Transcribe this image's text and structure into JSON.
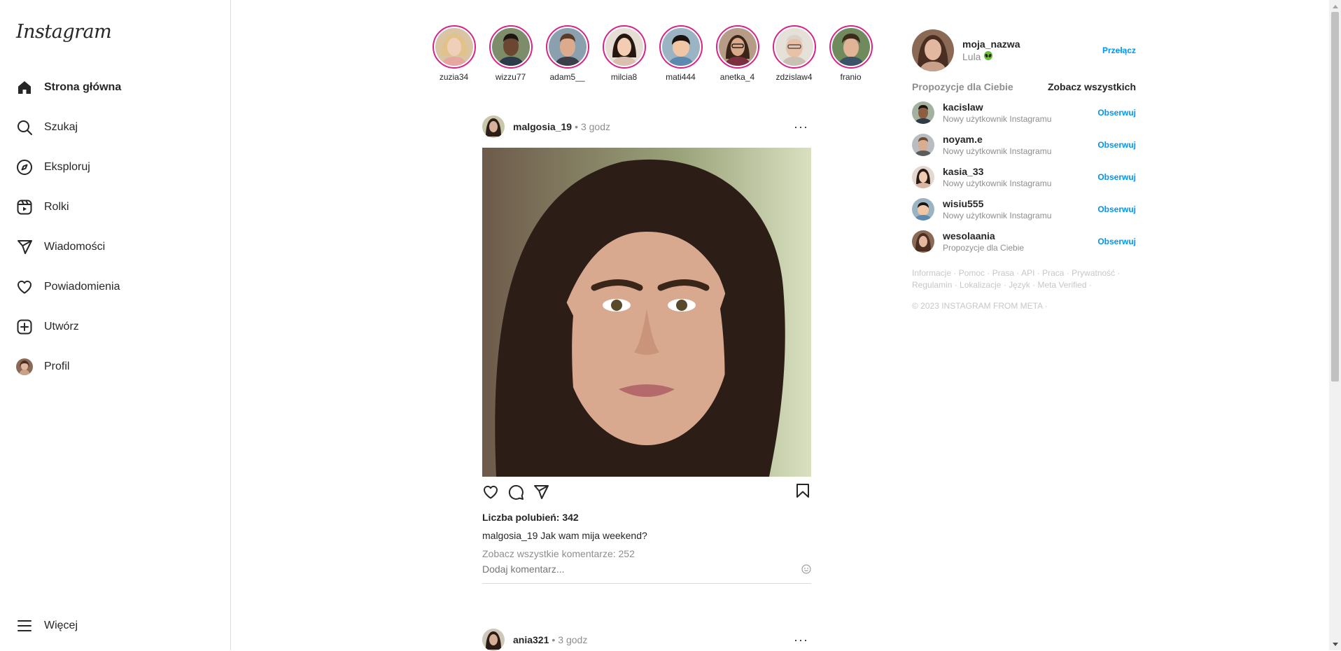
{
  "app": {
    "logo": "Instagram"
  },
  "nav": {
    "home": "Strona główna",
    "search": "Szukaj",
    "explore": "Eksploruj",
    "reels": "Rolki",
    "messages": "Wiadomości",
    "notifications": "Powiadomienia",
    "create": "Utwórz",
    "profile": "Profil",
    "more": "Więcej"
  },
  "stories": [
    {
      "name": "zuzia34"
    },
    {
      "name": "wizzu77"
    },
    {
      "name": "adam5__"
    },
    {
      "name": "milcia8"
    },
    {
      "name": "mati444"
    },
    {
      "name": "anetka_4"
    },
    {
      "name": "zdzislaw4"
    },
    {
      "name": "franio"
    }
  ],
  "post1": {
    "user": "malgosia_19",
    "dot": "•",
    "time": "3 godz",
    "menu": "···",
    "likes": "Liczba polubień: 342",
    "caption_user": "malgosia_19",
    "caption_text": "Jak wam mija weekend?",
    "comments_link": "Zobacz wszystkie komentarze: 252",
    "add_comment_placeholder": "Dodaj komentarz..."
  },
  "post2": {
    "user": "ania321",
    "dot": "•",
    "time": "3 godz",
    "menu": "···"
  },
  "me": {
    "username": "moja_nazwa",
    "name": "Lula",
    "switch": "Przełącz"
  },
  "suggestions": {
    "title": "Propozycje dla Ciebie",
    "see_all": "Zobacz wszystkich",
    "follow_label": "Obserwuj",
    "items": [
      {
        "user": "kacislaw",
        "sub": "Nowy użytkownik Instagramu"
      },
      {
        "user": "noyam.e",
        "sub": "Nowy użytkownik Instagramu"
      },
      {
        "user": "kasia_33",
        "sub": "Nowy użytkownik Instagramu"
      },
      {
        "user": "wisiu555",
        "sub": "Nowy użytkownik Instagramu"
      },
      {
        "user": "wesolaania",
        "sub": "Propozycje dla Ciebie"
      }
    ]
  },
  "footer": {
    "links": [
      "Informacje",
      "Pomoc",
      "Prasa",
      "API",
      "Praca",
      "Prywatność",
      "Regulamin",
      "Lokalizacje",
      "Język",
      "Meta Verified"
    ],
    "separator": " · ",
    "copyright": "© 2023 INSTAGRAM FROM META ·"
  },
  "colors": {
    "story_ring": "#d6248a",
    "link_blue": "#0095f6",
    "muted": "#8e8e8e",
    "border": "#dbdbdb"
  }
}
